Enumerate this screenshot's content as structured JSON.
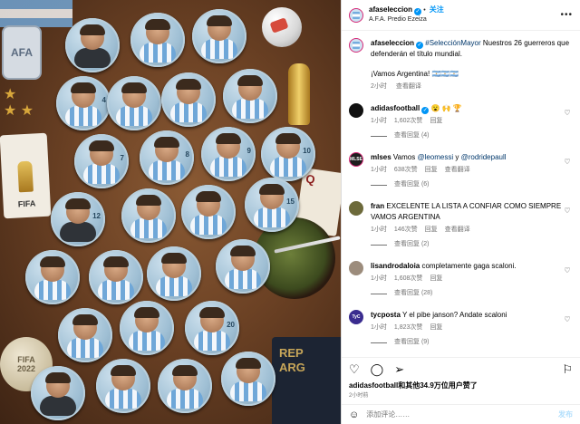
{
  "photo": {
    "badge_text": "AFA",
    "fifa_card_text": "FIFA",
    "coin_text": [
      "FIFA",
      "2022"
    ],
    "card_right_text": "Q",
    "passport_text": [
      "REP",
      "ARG"
    ],
    "pins": [
      {
        "num": "",
        "gk": true
      },
      {
        "num": "",
        "gk": false
      },
      {
        "num": "",
        "gk": false
      },
      {
        "num": "4",
        "gk": false
      },
      {
        "num": "",
        "gk": false
      },
      {
        "num": "",
        "gk": false
      },
      {
        "num": "",
        "gk": false
      },
      {
        "num": "7",
        "gk": false
      },
      {
        "num": "8",
        "gk": false
      },
      {
        "num": "9",
        "gk": false
      },
      {
        "num": "10",
        "gk": false
      },
      {
        "num": "12",
        "gk": true
      },
      {
        "num": "",
        "gk": false
      },
      {
        "num": "",
        "gk": false
      },
      {
        "num": "15",
        "gk": false
      },
      {
        "num": "",
        "gk": false
      },
      {
        "num": "",
        "gk": false
      },
      {
        "num": "",
        "gk": false
      },
      {
        "num": "",
        "gk": false
      },
      {
        "num": "",
        "gk": false
      },
      {
        "num": "",
        "gk": false
      },
      {
        "num": "20",
        "gk": false
      },
      {
        "num": "",
        "gk": true
      },
      {
        "num": "",
        "gk": false
      },
      {
        "num": "",
        "gk": false
      },
      {
        "num": "",
        "gk": false
      }
    ]
  },
  "header": {
    "username": "afaseleccion",
    "follow_label": "关注",
    "subtitle": "A.F.A. Predio Ezeiza"
  },
  "caption": {
    "username": "afaseleccion",
    "hashtag": "#SelecciónMayor",
    "text": " Nuestros 26 guerreros que defenderán el título mundial.",
    "text2": "¡Vamos Argentina! 🇦🇷🇦🇷🇦🇷",
    "time": "2小时",
    "translate": "查看翻译"
  },
  "comments": [
    {
      "username": "adidasfootball",
      "text": " 😮 🙌 🏆",
      "time": "1小时",
      "likes": "1,602次赞",
      "reply": "回复",
      "replies": "查看回复 (4)",
      "avatar": "adidas"
    },
    {
      "username": "mlses",
      "text_pre": "Vamos ",
      "mention1": "@leomessi",
      "text_mid": " y ",
      "mention2": "@rodridepaull",
      "time": "1小时",
      "likes": "638次赞",
      "reply": "回复",
      "translate": "查看翻译",
      "replies": "查看回复 (6)",
      "avatar": "mls",
      "avatar_label": "MLSE"
    },
    {
      "username": "fran",
      "text": "EXCELENTE LA LISTA A CONFIAR COMO SIEMPRE VAMOS ARGENTINA",
      "time": "1小时",
      "likes": "146次赞",
      "reply": "回复",
      "translate": "查看翻译",
      "replies": "查看回复 (2)",
      "avatar": "fran"
    },
    {
      "username": "lisandrodaloia",
      "text": "completamente gaga scaloni.",
      "time": "1小时",
      "likes": "1,608次赞",
      "reply": "回复",
      "replies": "查看回复 (28)",
      "avatar": "lisa"
    },
    {
      "username": "tycposta",
      "text": "Y el pibe janson? Andate scaloni",
      "time": "1小时",
      "likes": "1,823次赞",
      "reply": "回复",
      "replies": "查看回复 (9)",
      "avatar": "tyc",
      "avatar_label": "TyC"
    }
  ],
  "footer": {
    "liked_by": "adidasfootball和其他34.9万位用户赞了",
    "posted_ago": "2小时前",
    "comment_placeholder": "添加评论……",
    "post_label": "发布"
  }
}
